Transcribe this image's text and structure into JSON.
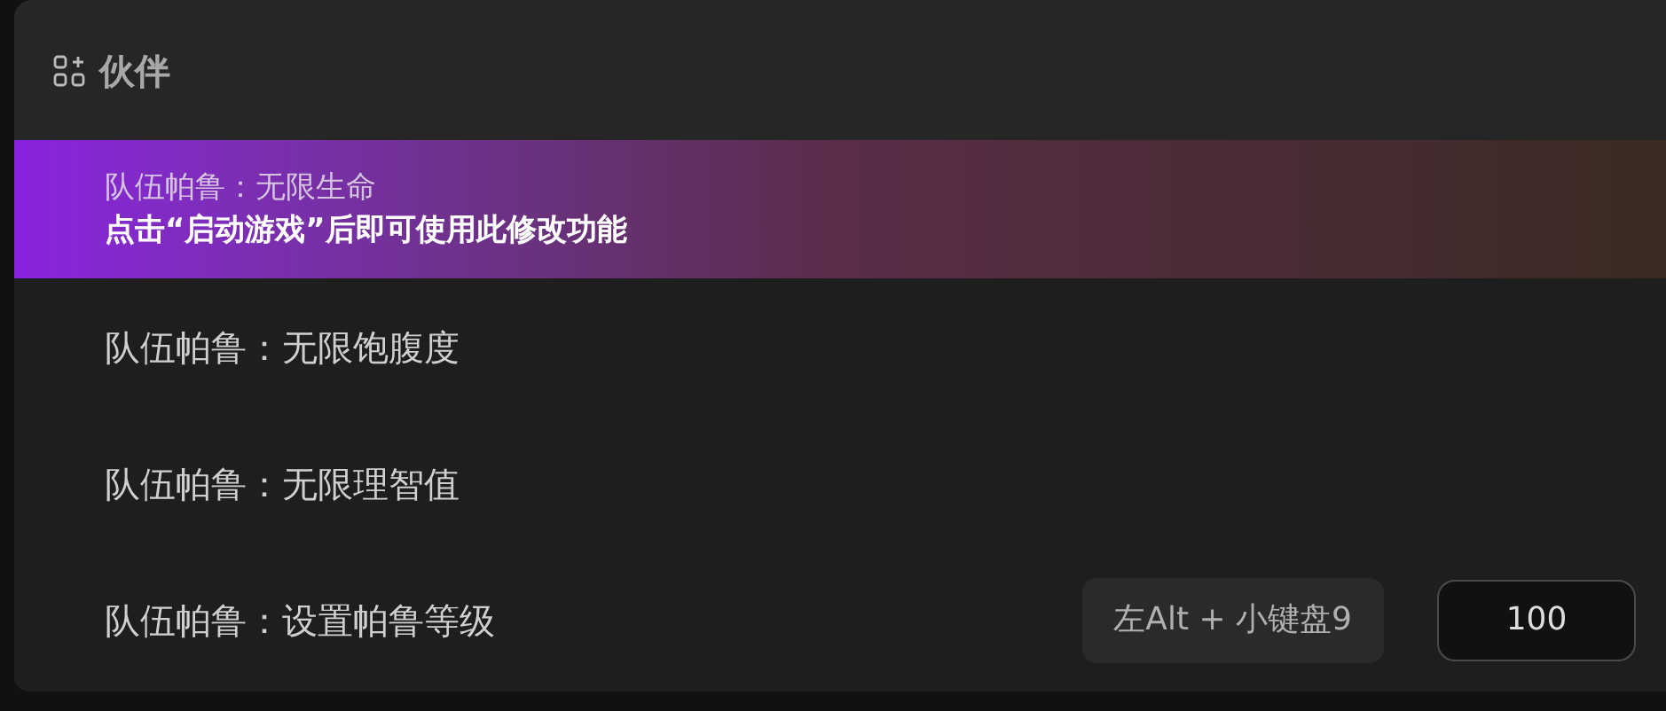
{
  "section": {
    "title": "伙伴"
  },
  "items": [
    {
      "kind": "toggle",
      "label": "队伍帕鲁：无限生命",
      "selected": true,
      "hint": "点击“启动游戏”后即可使用此修改功能"
    },
    {
      "kind": "toggle",
      "label": "队伍帕鲁：无限饱腹度",
      "selected": false
    },
    {
      "kind": "toggle",
      "label": "队伍帕鲁：无限理智值",
      "selected": false
    },
    {
      "kind": "value",
      "label": "队伍帕鲁：设置帕鲁等级",
      "selected": false,
      "hotkey": "左Alt + 小键盘9",
      "value": "100"
    }
  ]
}
